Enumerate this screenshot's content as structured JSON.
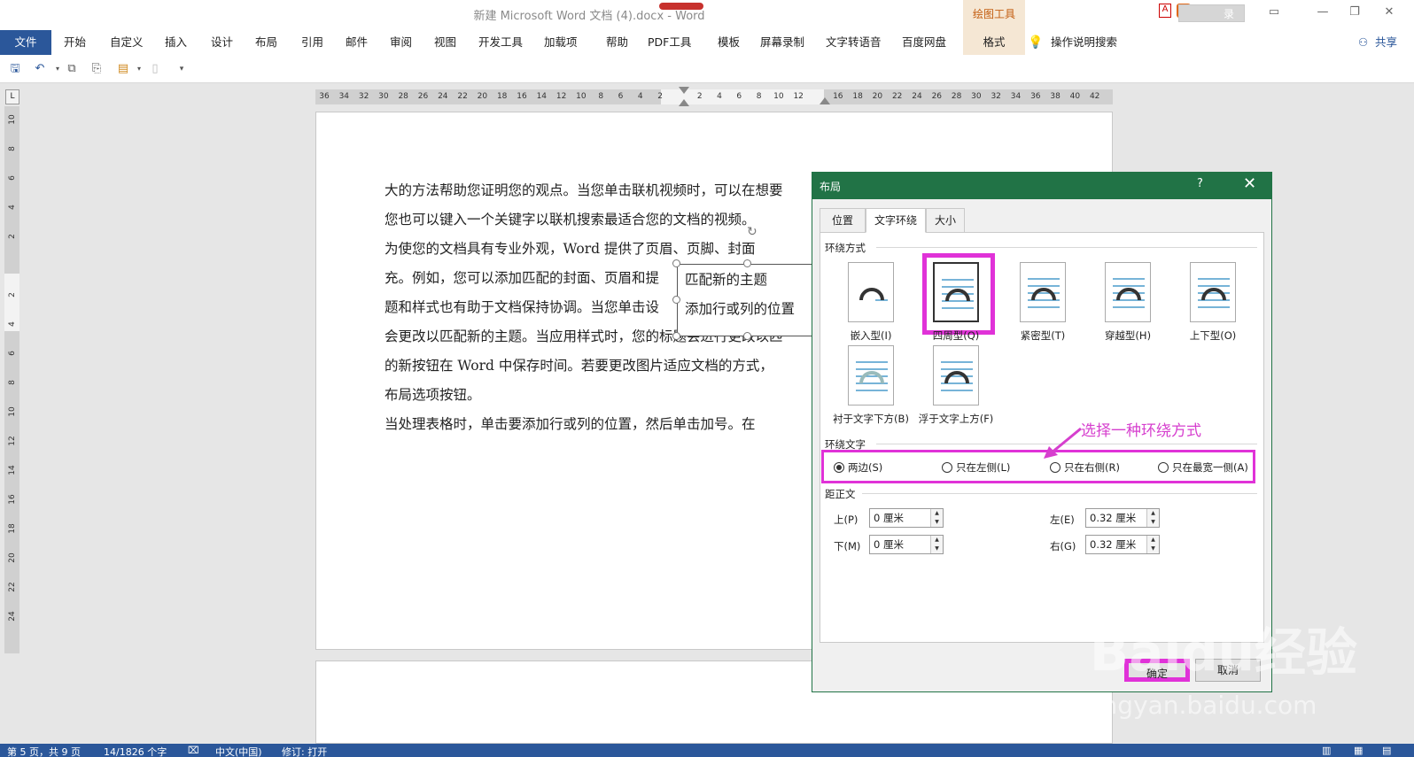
{
  "window": {
    "title": "新建 Microsoft Word 文档 (4).docx  -  Word",
    "context_tab_group": "绘图工具",
    "login_label": "录",
    "controls": [
      "restore-icon",
      "minimize-icon",
      "maximize-icon",
      "close-icon"
    ]
  },
  "ribbon": {
    "file": "文件",
    "tabs": [
      "开始",
      "自定义",
      "插入",
      "设计",
      "布局",
      "引用",
      "邮件",
      "审阅",
      "视图",
      "开发工具",
      "加载项",
      "帮助",
      "PDF工具",
      "模板",
      "屏幕录制",
      "文字转语音",
      "百度网盘"
    ],
    "format_tab": "格式",
    "tell_me": "操作说明搜索",
    "share": "共享"
  },
  "ruler": {
    "h_ticks": [
      "36",
      "34",
      "32",
      "30",
      "28",
      "26",
      "24",
      "22",
      "20",
      "18",
      "16",
      "14",
      "12",
      "10",
      "8",
      "6",
      "4",
      "2",
      "",
      "2",
      "4",
      "6",
      "8",
      "10",
      "12",
      "",
      "16",
      "18",
      "20",
      "22",
      "24",
      "26",
      "28",
      "30",
      "32",
      "34",
      "36",
      "38",
      "40",
      "42"
    ],
    "v_ticks": [
      "10",
      "8",
      "6",
      "4",
      "2",
      "",
      "2",
      "4",
      "6",
      "8",
      "10",
      "12",
      "14",
      "16",
      "18",
      "20",
      "22",
      "24"
    ],
    "corner": "L"
  },
  "document": {
    "lines": [
      "大的方法帮助您证明您的观点。当您单击联机视频时，可以在想要",
      "您也可以键入一个关键字以联机搜索最适合您的文档的视频。",
      "    为使您的文档具有专业外观，Word 提供了页眉、页脚、封面",
      "充。例如，您可以添加匹配的封面、页眉和提",
      "题和样式也有助于文档保持协调。当您单击设",
      "会更改以匹配新的主题。当应用样式时，您的标题会进行更改以匹",
      "的新按钮在 Word 中保存时间。若要更改图片适应文档的方式，",
      "布局选项按钮。",
      "    当处理表格时，单击要添加行或列的位置，然后单击加号。在"
    ],
    "textbox_lines": [
      "匹配新的主题",
      "添加行或列的位置"
    ]
  },
  "dialog": {
    "title": "布局",
    "help": "?",
    "tabs": [
      "位置",
      "文字环绕",
      "大小"
    ],
    "active_tab": "文字环绕",
    "wrap_style_group": "环绕方式",
    "wrap_styles": [
      {
        "label": "嵌入型(I)",
        "icon": "inline-wrap-icon"
      },
      {
        "label": "四周型(Q)",
        "icon": "square-wrap-icon",
        "selected": true
      },
      {
        "label": "紧密型(T)",
        "icon": "tight-wrap-icon"
      },
      {
        "label": "穿越型(H)",
        "icon": "through-wrap-icon"
      },
      {
        "label": "上下型(O)",
        "icon": "top-bottom-wrap-icon"
      },
      {
        "label": "衬于文字下方(B)",
        "icon": "behind-text-icon"
      },
      {
        "label": "浮于文字上方(F)",
        "icon": "in-front-text-icon"
      }
    ],
    "wrap_text_group": "环绕文字",
    "wrap_text_options": [
      "两边(S)",
      "只在左侧(L)",
      "只在右侧(R)",
      "只在最宽一侧(A)"
    ],
    "wrap_text_selected": "两边(S)",
    "distance_group": "距正文",
    "distance": {
      "top_label": "上(P)",
      "top_value": "0 厘米",
      "bottom_label": "下(M)",
      "bottom_value": "0 厘米",
      "left_label": "左(E)",
      "left_value": "0.32 厘米",
      "right_label": "右(G)",
      "right_value": "0.32 厘米"
    },
    "ok": "确定",
    "cancel": "取消"
  },
  "annotation": "选择一种环绕方式",
  "status": {
    "page": "第 5 页，共 9 页",
    "words": "14/1826 个字",
    "language": "中文(中国)",
    "track": "修订: 打开"
  },
  "colors": {
    "accent": "#2b579a",
    "dialog_green": "#217346",
    "highlight": "#e032d8",
    "context_orange": "#c35d10"
  },
  "watermark": {
    "brand": "Baidu经验",
    "url": "jingyan.baidu.com"
  }
}
